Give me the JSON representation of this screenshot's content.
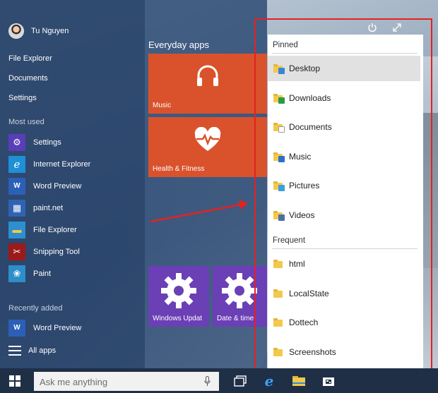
{
  "user": {
    "name": "Tu Nguyen"
  },
  "places": [
    "File Explorer",
    "Documents",
    "Settings"
  ],
  "most_used": {
    "heading": "Most used",
    "items": [
      {
        "label": "Settings",
        "icon": "gear-icon",
        "color": "#5a3db8",
        "glyph": "⚙"
      },
      {
        "label": "Internet Explorer",
        "icon": "internet-explorer-icon",
        "color": "#1f8fd6",
        "glyph": "e"
      },
      {
        "label": "Word Preview",
        "icon": "word-icon",
        "color": "#2b5fb8",
        "glyph": "W"
      },
      {
        "label": "paint.net",
        "icon": "paintnet-icon",
        "color": "#2f63b5",
        "glyph": "▦"
      },
      {
        "label": "File Explorer",
        "icon": "file-explorer-icon",
        "color": "#2c8fd0",
        "glyph": "▬"
      },
      {
        "label": "Snipping Tool",
        "icon": "scissors-icon",
        "color": "#9b1b1b",
        "glyph": "✂"
      },
      {
        "label": "Paint",
        "icon": "paint-palette-icon",
        "color": "#2d8fc9",
        "glyph": "❀"
      }
    ]
  },
  "recently_added": {
    "heading": "Recently added",
    "items": [
      {
        "label": "Word Preview",
        "icon": "word-icon",
        "color": "#2b5fb8",
        "glyph": "W"
      }
    ]
  },
  "all_apps": {
    "label": "All apps"
  },
  "tiles": {
    "group_title": "Everyday apps",
    "items": [
      {
        "label": "Music",
        "icon": "headphones-icon"
      },
      {
        "label": "Health & Fitness",
        "icon": "heart-pulse-icon"
      },
      {
        "label": "Windows Updat",
        "icon": "gear-icon"
      },
      {
        "label": "Date & time",
        "icon": "gear-icon"
      }
    ]
  },
  "jump_list": {
    "pinned_heading": "Pinned",
    "pinned": [
      {
        "label": "Desktop",
        "badge": "#3a86d6",
        "selected": true
      },
      {
        "label": "Downloads",
        "badge": "#2d9a47"
      },
      {
        "label": "Documents",
        "badge": "#ffffff"
      },
      {
        "label": "Music",
        "badge": "#2b70c9"
      },
      {
        "label": "Pictures",
        "badge": "#3b9fe0"
      },
      {
        "label": "Videos",
        "badge": "#4d6fa5"
      }
    ],
    "frequent_heading": "Frequent",
    "frequent": [
      {
        "label": "html"
      },
      {
        "label": "LocalState"
      },
      {
        "label": "Dottech"
      },
      {
        "label": "Screenshots"
      }
    ]
  },
  "taskbar": {
    "search_placeholder": "Ask me anything"
  },
  "colors": {
    "highlight": "#e32222",
    "tile_orange": "#d9522c",
    "tile_purple": "#6b3fb5"
  }
}
